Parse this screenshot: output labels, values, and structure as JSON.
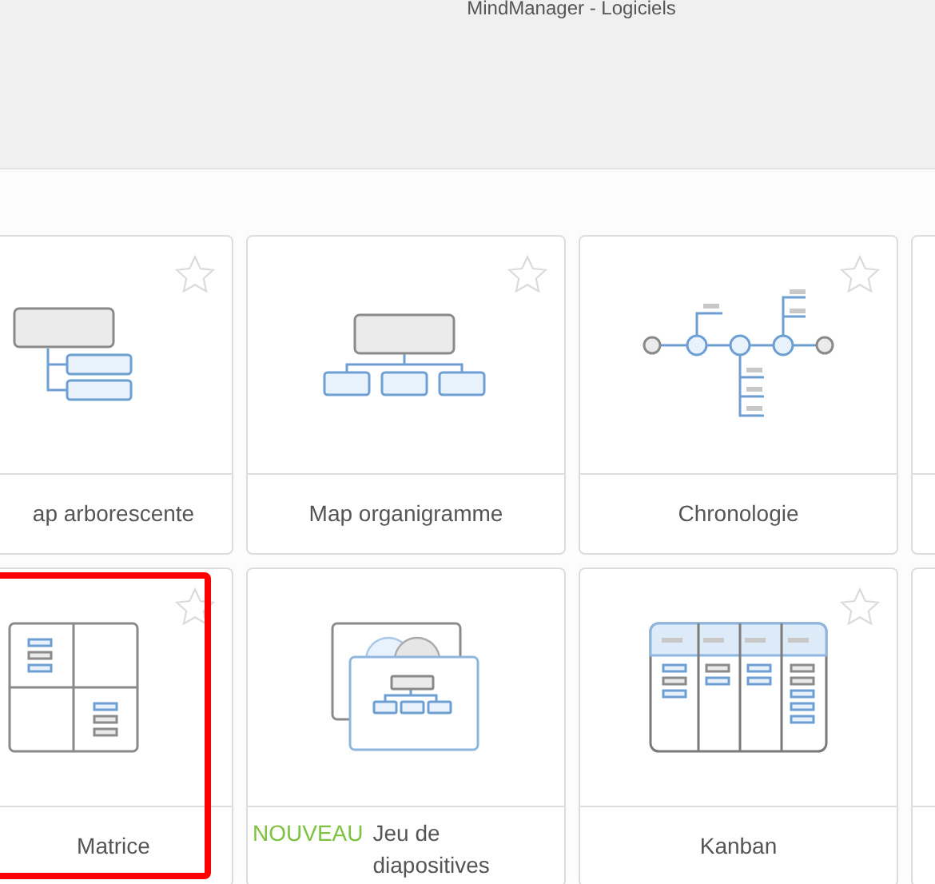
{
  "window": {
    "title": "MindManager - Logiciels"
  },
  "templates": [
    {
      "label": "ap arborescente",
      "kind": "tree",
      "favorite": false,
      "highlighted": false
    },
    {
      "label": "Map organigramme",
      "kind": "org",
      "favorite": false,
      "highlighted": false
    },
    {
      "label": "Chronologie",
      "kind": "timeline",
      "favorite": false,
      "highlighted": false
    },
    {
      "kind": "blank"
    },
    {
      "label": "Matrice",
      "kind": "matrix",
      "favorite": false,
      "highlighted": true
    },
    {
      "label": "Jeu de diapositives",
      "badge": "NOUVEAU",
      "kind": "slides",
      "highlighted": false
    },
    {
      "label": "Kanban",
      "kind": "kanban",
      "favorite": false,
      "highlighted": false
    },
    {
      "kind": "blank"
    }
  ]
}
